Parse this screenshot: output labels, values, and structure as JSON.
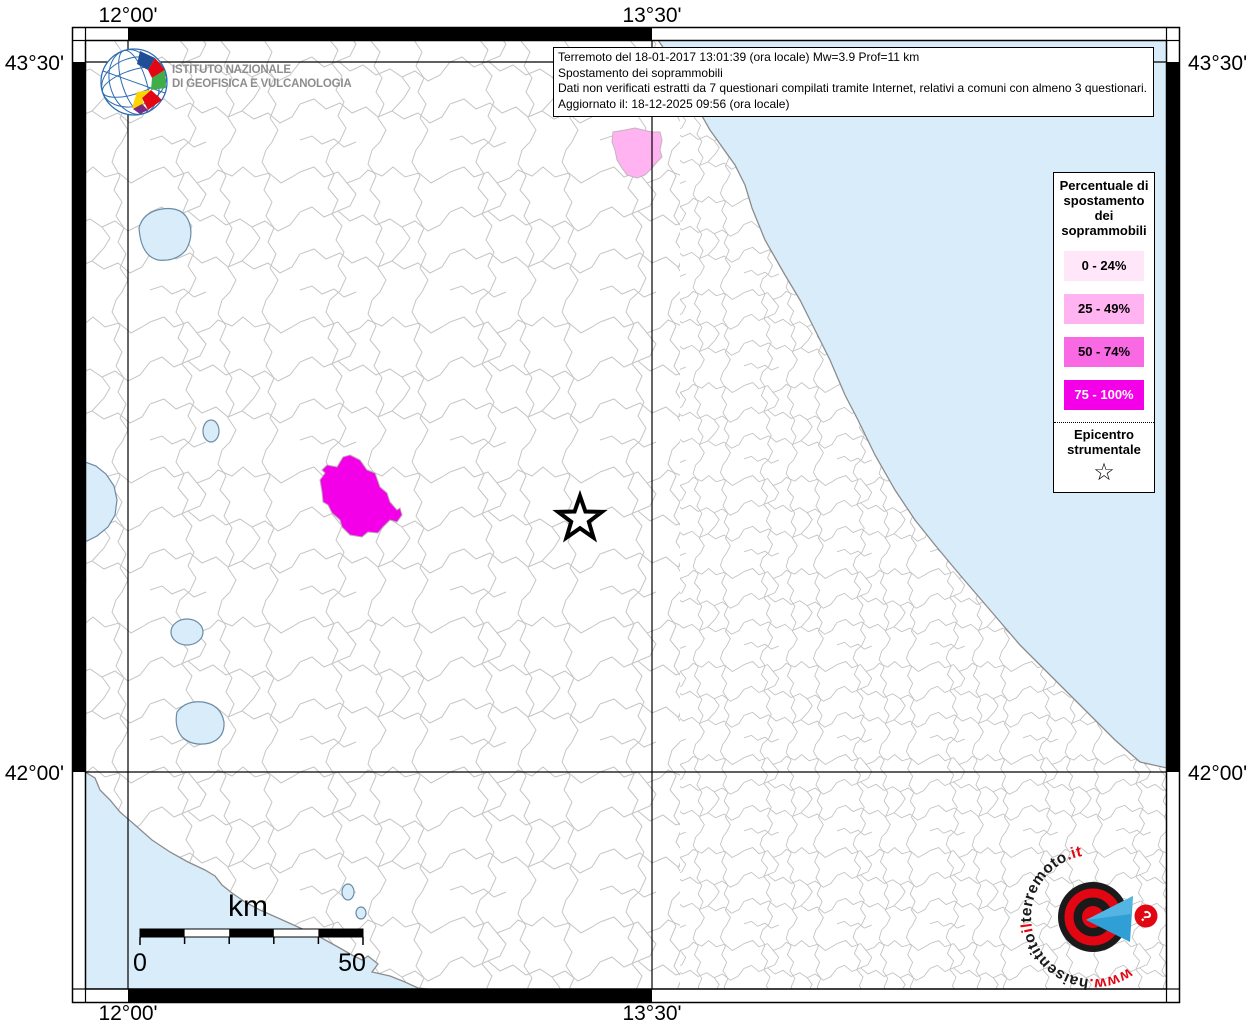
{
  "info_box": {
    "lines": [
      "Terremoto del 18-01-2017 13:01:39 (ora locale) Mw=3.9 Prof=11 km",
      "Spostamento dei soprammobili",
      "Dati non verificati estratti da 7 questionari compilati tramite Internet, relativi a comuni con almeno 3 questionari.",
      "Aggiornato il: 18-12-2025 09:56 (ora locale)"
    ]
  },
  "coordinates": {
    "lon": [
      "12°00'",
      "13°30'"
    ],
    "lat": [
      "43°30'",
      "42°00'"
    ]
  },
  "legend": {
    "title": "Percentuale di spostamento dei soprammobili",
    "classes": [
      {
        "label": "0 - 24%",
        "color": "#ffe6f8",
        "text": "#000000"
      },
      {
        "label": "25 - 49%",
        "color": "#ffb3f0",
        "text": "#000000"
      },
      {
        "label": "50 - 74%",
        "color": "#fa69e4",
        "text": "#000000"
      },
      {
        "label": "75 - 100%",
        "color": "#f400e8",
        "text": "#ffffff"
      }
    ],
    "epicenter_label": "Epicentro strumentale",
    "star_glyph": "☆"
  },
  "scale_bar": {
    "unit": "km",
    "start_label": "0",
    "end_label": "50"
  },
  "ingv_logo": {
    "line1": "ISTITUTO NAZIONALE",
    "line2": "DI GEOFISICA E VULCANOLOGIA"
  },
  "site_logo": {
    "www": "www.",
    "part1": "haisentito",
    "part2": "il",
    "part3": "terremoto",
    "tld": ".it",
    "question_mark": "?"
  },
  "map": {
    "sea_color": "#d8ecfa",
    "boundary_color": "#c5c5c5",
    "highlighted_municipalities": [
      {
        "class": "75 - 100%",
        "color": "#f400e8"
      },
      {
        "class": "25 - 49%",
        "color": "#ffb3f0"
      }
    ],
    "epicenter_symbol": "star"
  }
}
